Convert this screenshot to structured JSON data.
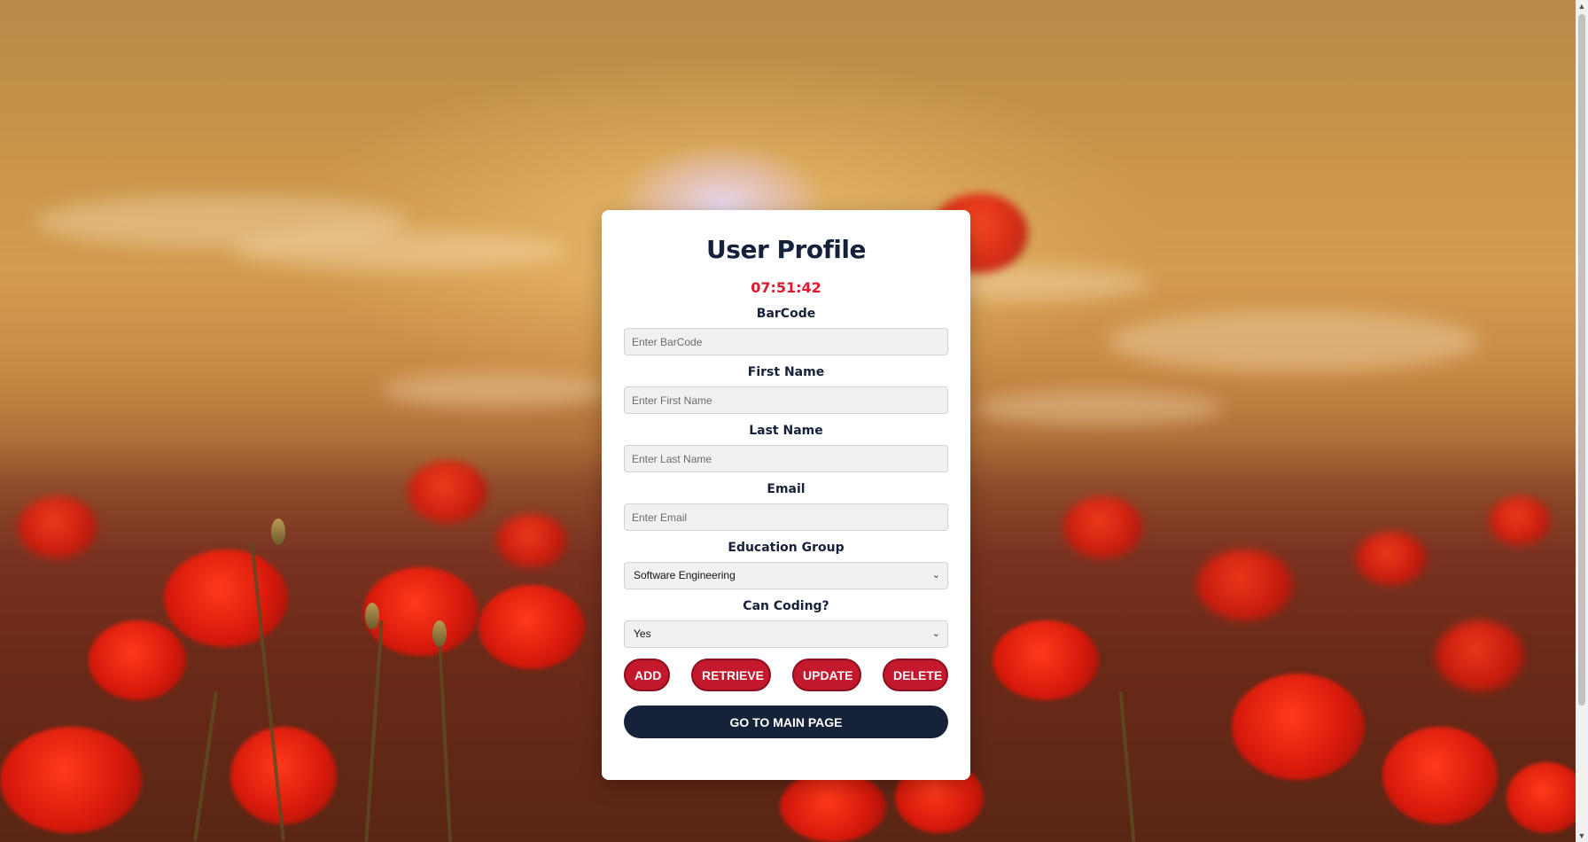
{
  "page": {
    "title": "User Profile",
    "clock": "07:51:42"
  },
  "form": {
    "barcode": {
      "label": "BarCode",
      "placeholder": "Enter BarCode",
      "value": ""
    },
    "first_name": {
      "label": "First Name",
      "placeholder": "Enter First Name",
      "value": ""
    },
    "last_name": {
      "label": "Last Name",
      "placeholder": "Enter Last Name",
      "value": ""
    },
    "email": {
      "label": "Email",
      "placeholder": "Enter Email",
      "value": ""
    },
    "education_group": {
      "label": "Education Group",
      "selected": "Software Engineering"
    },
    "can_coding": {
      "label": "Can Coding?",
      "selected": "Yes"
    }
  },
  "actions": {
    "add": "ADD",
    "retrieve": "RETRIEVE",
    "update": "UPDATE",
    "delete": "DELETE",
    "main_page": "GO TO MAIN PAGE"
  },
  "colors": {
    "accent_red": "#c4182c",
    "clock_red": "#e0182d",
    "navy": "#16213a",
    "card_bg": "#ffffff"
  },
  "icons": {
    "select_chevron": "chevron-down-icon",
    "scroll_up": "scroll-up-arrow-icon",
    "scroll_down": "scroll-down-arrow-icon"
  }
}
